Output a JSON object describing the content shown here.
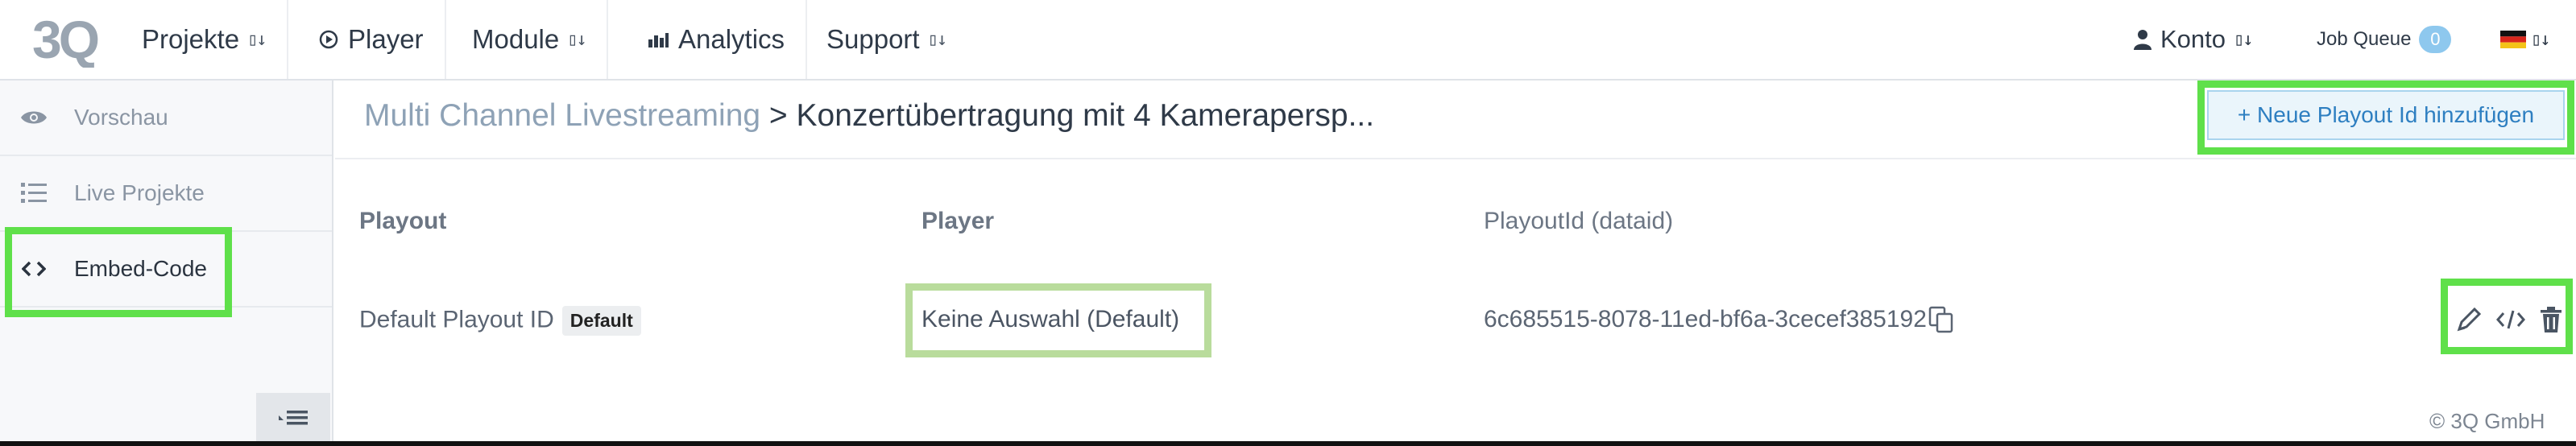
{
  "nav": {
    "logo_text": "3Q",
    "items": [
      {
        "label": "Projekte",
        "caret": "▯↓"
      },
      {
        "label": "Player"
      },
      {
        "label": "Module",
        "caret": "▯↓"
      },
      {
        "label": "Analytics"
      },
      {
        "label": "Support",
        "caret": "▯↓"
      }
    ],
    "account": {
      "label": "Konto",
      "caret": "▯↓"
    },
    "job_queue": {
      "label": "Job Queue",
      "count": "0"
    },
    "language": {
      "caret": "▯↓"
    }
  },
  "sidebar": {
    "items": [
      {
        "label": "Vorschau",
        "icon": "eye-icon"
      },
      {
        "label": "Live Projekte",
        "icon": "list-icon"
      },
      {
        "label": "Embed-Code",
        "icon": "code-icon",
        "active": true
      }
    ]
  },
  "breadcrumb": {
    "parent": "Multi Channel Livestreaming",
    "separator": ">",
    "current": "Konzertübertragung mit 4 Kamerapersp..."
  },
  "add_button_label": "+ Neue Playout Id hinzufügen",
  "table": {
    "headers": [
      "Playout",
      "Player",
      "PlayoutId (dataid)"
    ],
    "rows": [
      {
        "playout": "Default Playout ID",
        "tag": "Default",
        "player": "Keine Auswahl (Default)",
        "playout_id": "6c685515-8078-11ed-bf6a-3cecef385192"
      }
    ]
  },
  "footer": "© 3Q GmbH",
  "colors": {
    "highlight": "#5fe04a",
    "link": "#8ea2b6",
    "button_text": "#2e7fc1",
    "badge": "#8ec8ee"
  }
}
